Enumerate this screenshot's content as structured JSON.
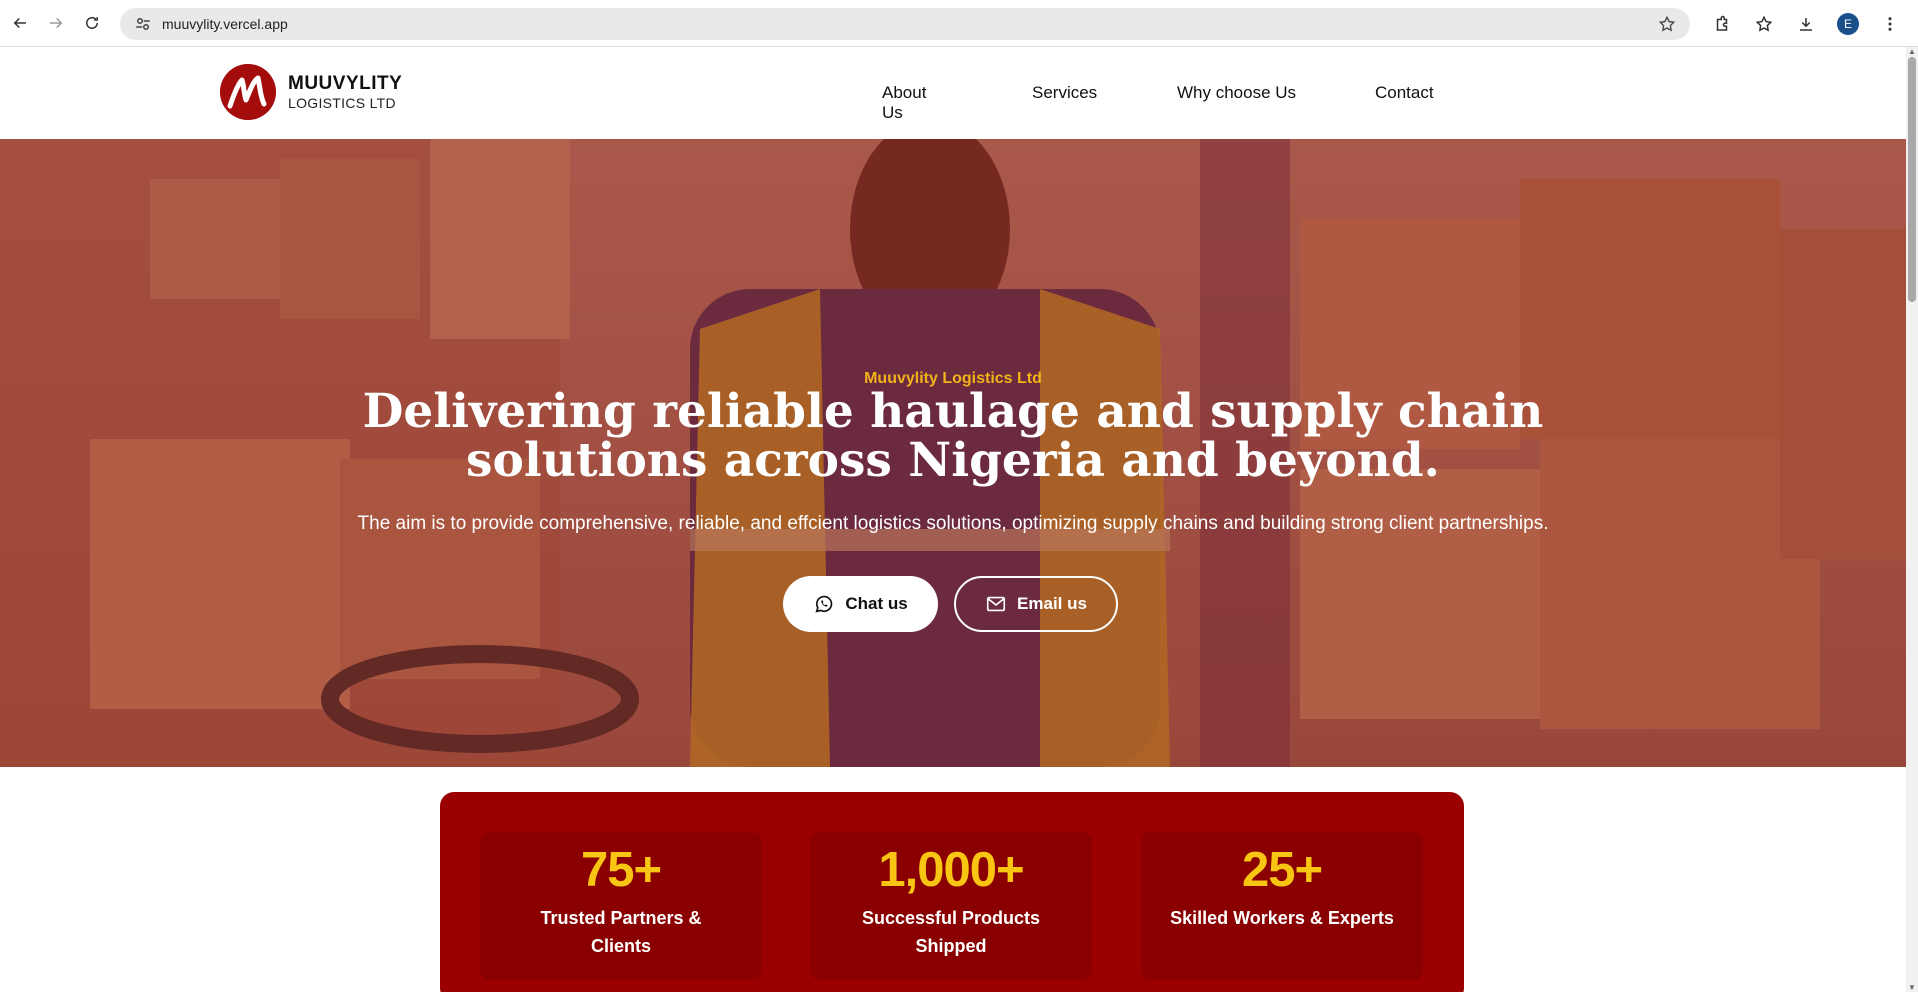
{
  "browser": {
    "url": "muuvylity.vercel.app",
    "profile_initial": "E"
  },
  "header": {
    "logo_name": "MUUVYLITY",
    "logo_sub": "LOGISTICS LTD",
    "nav": [
      {
        "label": "About Us"
      },
      {
        "label": "Services"
      },
      {
        "label": "Why choose Us"
      },
      {
        "label": "Contact"
      }
    ]
  },
  "hero": {
    "eyebrow": "Muuvylity Logistics Ltd",
    "headline_line1": "Delivering reliable haulage and supply chain",
    "headline_line2": "solutions across Nigeria and beyond.",
    "lede": "The aim is to provide comprehensive, reliable, and effcient logistics solutions, optimizing supply chains and building strong client partnerships.",
    "chat_label": "Chat us",
    "email_label": "Email us"
  },
  "stats": [
    {
      "value": "75+",
      "label": "Trusted Partners & Clients"
    },
    {
      "value": "1,000+",
      "label": "Successful Products Shipped"
    },
    {
      "value": "25+",
      "label": "Skilled Workers & Experts"
    }
  ],
  "colors": {
    "brand_red": "#9b0000",
    "accent_gold": "#f2b21a",
    "stat_number": "#f7c512"
  }
}
